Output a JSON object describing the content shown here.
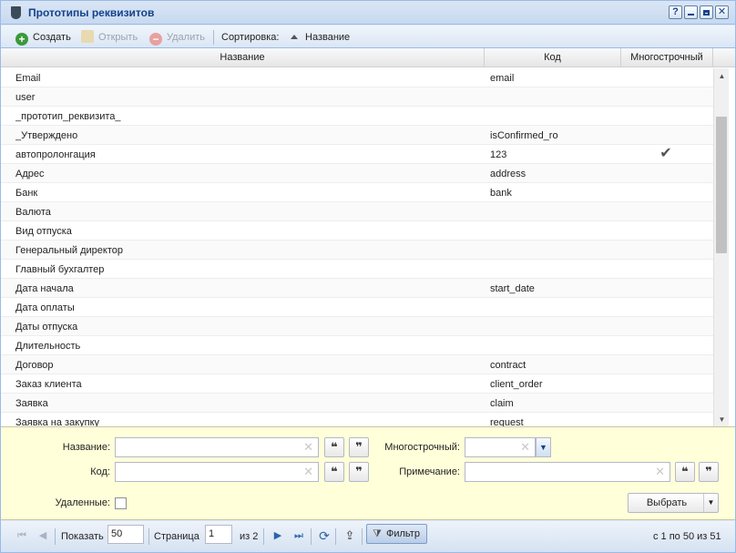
{
  "window": {
    "title": "Прототипы реквизитов"
  },
  "toolbar": {
    "create": "Создать",
    "open": "Открыть",
    "delete": "Удалить",
    "sort_label": "Сортировка:",
    "sort_field": "Название"
  },
  "grid": {
    "columns": {
      "name": "Название",
      "code": "Код",
      "multiline": "Многострочный"
    },
    "rows": [
      {
        "name": "Email",
        "code": "email",
        "multiline": ""
      },
      {
        "name": "user",
        "code": "",
        "multiline": ""
      },
      {
        "name": "_прототип_реквизита_",
        "code": "",
        "multiline": ""
      },
      {
        "name": "_Утверждено",
        "code": "isConfirmed_ro",
        "multiline": ""
      },
      {
        "name": "автопролонгация",
        "code": "123",
        "multiline": "✔"
      },
      {
        "name": "Адрес",
        "code": "address",
        "multiline": ""
      },
      {
        "name": "Банк",
        "code": "bank",
        "multiline": ""
      },
      {
        "name": "Валюта",
        "code": "",
        "multiline": ""
      },
      {
        "name": "Вид отпуска",
        "code": "",
        "multiline": ""
      },
      {
        "name": "Генеральный директор",
        "code": "",
        "multiline": ""
      },
      {
        "name": "Главный бухгалтер",
        "code": "",
        "multiline": ""
      },
      {
        "name": "Дата начала",
        "code": "start_date",
        "multiline": ""
      },
      {
        "name": "Дата оплаты",
        "code": "",
        "multiline": ""
      },
      {
        "name": "Даты отпуска",
        "code": "",
        "multiline": ""
      },
      {
        "name": "Длительность",
        "code": "",
        "multiline": ""
      },
      {
        "name": "Договор",
        "code": "contract",
        "multiline": ""
      },
      {
        "name": "Заказ клиента",
        "code": "client_order",
        "multiline": ""
      },
      {
        "name": "Заявка",
        "code": "claim",
        "multiline": ""
      },
      {
        "name": "Заявка на закупку",
        "code": "request",
        "multiline": ""
      }
    ]
  },
  "filter": {
    "name_label": "Название:",
    "code_label": "Код:",
    "multiline_label": "Многострочный:",
    "note_label": "Примечание:",
    "deleted_label": "Удаленные:",
    "choose_button": "Выбрать",
    "name_value": "",
    "code_value": "",
    "multiline_value": "",
    "note_value": ""
  },
  "pager": {
    "show_label": "Показать",
    "page_size": "50",
    "page_label": "Страница",
    "page_value": "1",
    "of_pages": "из 2",
    "filter_button": "Фильтр",
    "summary": "с 1 по 50 из 51"
  },
  "icons": {
    "title": "window-icon",
    "create": "plus-circle-icon",
    "open": "open-doc-icon",
    "delete": "minus-circle-icon",
    "sort": "sort-asc-icon",
    "refresh": "refresh-icon",
    "export": "export-icon",
    "filter": "funnel-icon"
  }
}
